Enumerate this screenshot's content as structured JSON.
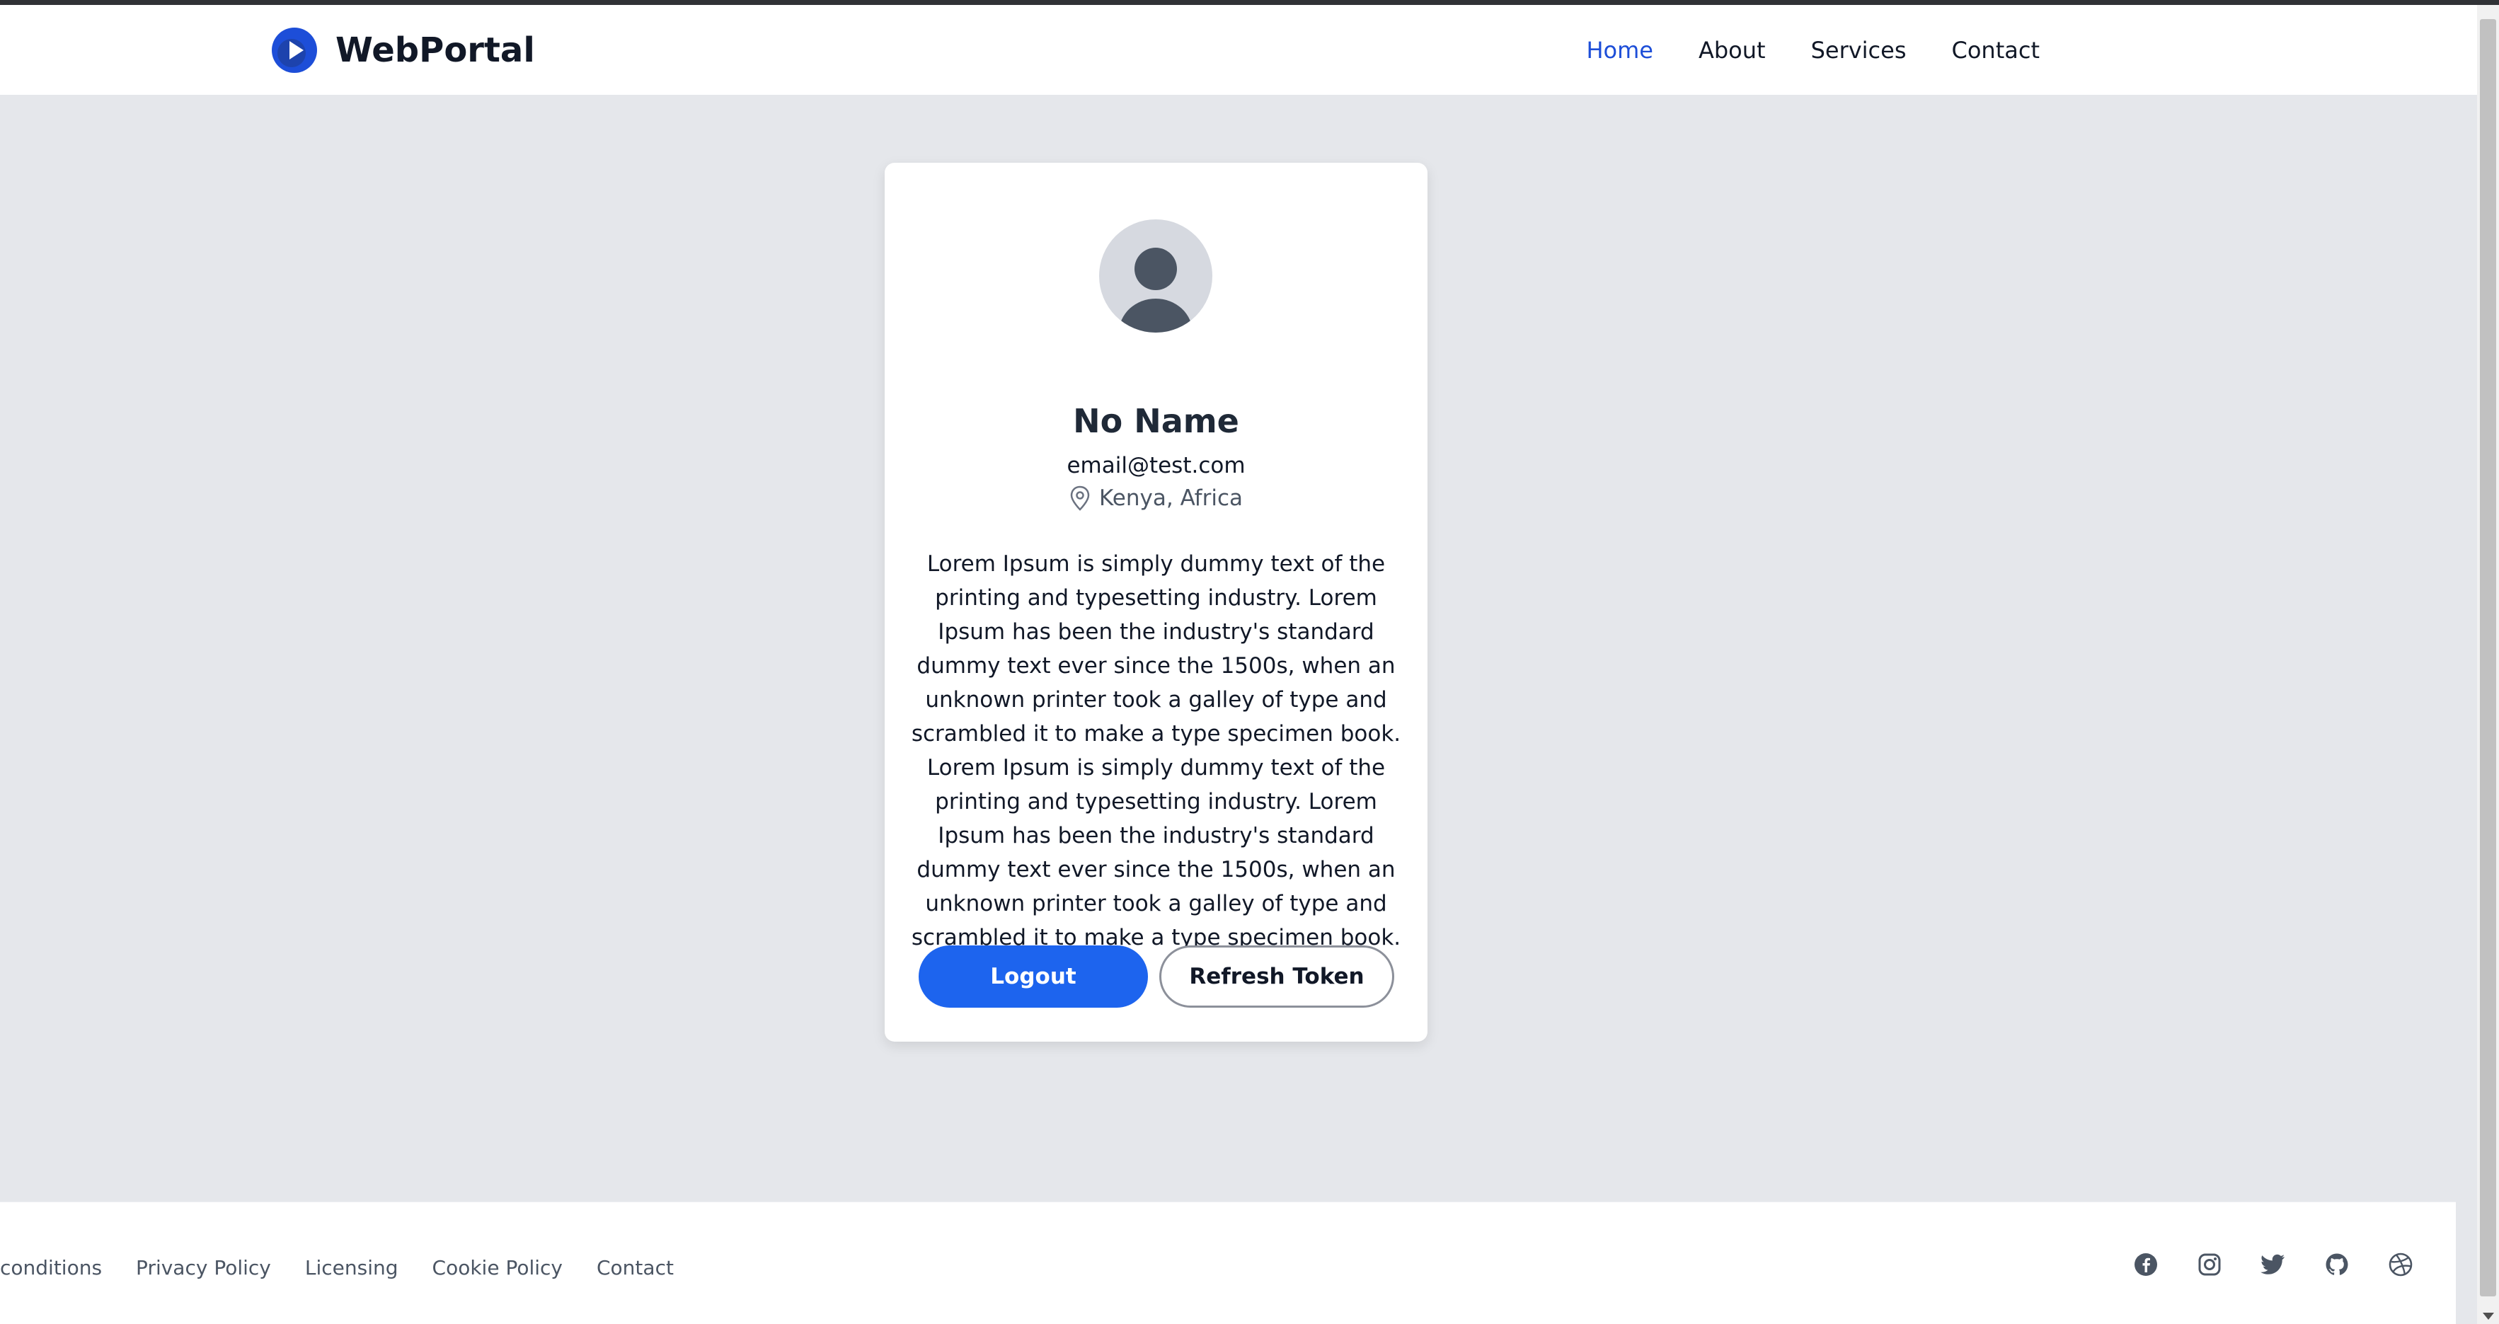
{
  "header": {
    "brand": "WebPortal",
    "nav": [
      "Home",
      "About",
      "Services",
      "Contact"
    ],
    "active_nav": "Home"
  },
  "profile": {
    "name": "No Name",
    "email": "email@test.com",
    "location": "Kenya, Africa",
    "bio": "Lorem Ipsum is simply dummy text of the printing and typesetting industry. Lorem Ipsum has been the industry's standard dummy text ever since the 1500s, when an unknown printer took a galley of type and scrambled it to make a type specimen book. Lorem Ipsum is simply dummy text of the printing and typesetting industry. Lorem Ipsum has been the industry's standard dummy text ever since the 1500s, when an unknown printer took a galley of type and scrambled it to make a type specimen book.",
    "logout_label": "Logout",
    "refresh_label": "Refresh Token"
  },
  "footer": {
    "links": [
      "conditions",
      "Privacy Policy",
      "Licensing",
      "Cookie Policy",
      "Contact"
    ],
    "socials": [
      "facebook-icon",
      "instagram-icon",
      "twitter-icon",
      "github-icon",
      "dribbble-icon"
    ]
  },
  "colors": {
    "accent": "#1d64ee",
    "active_nav": "#1d4ed8",
    "page_bg": "#e5e7eb"
  }
}
